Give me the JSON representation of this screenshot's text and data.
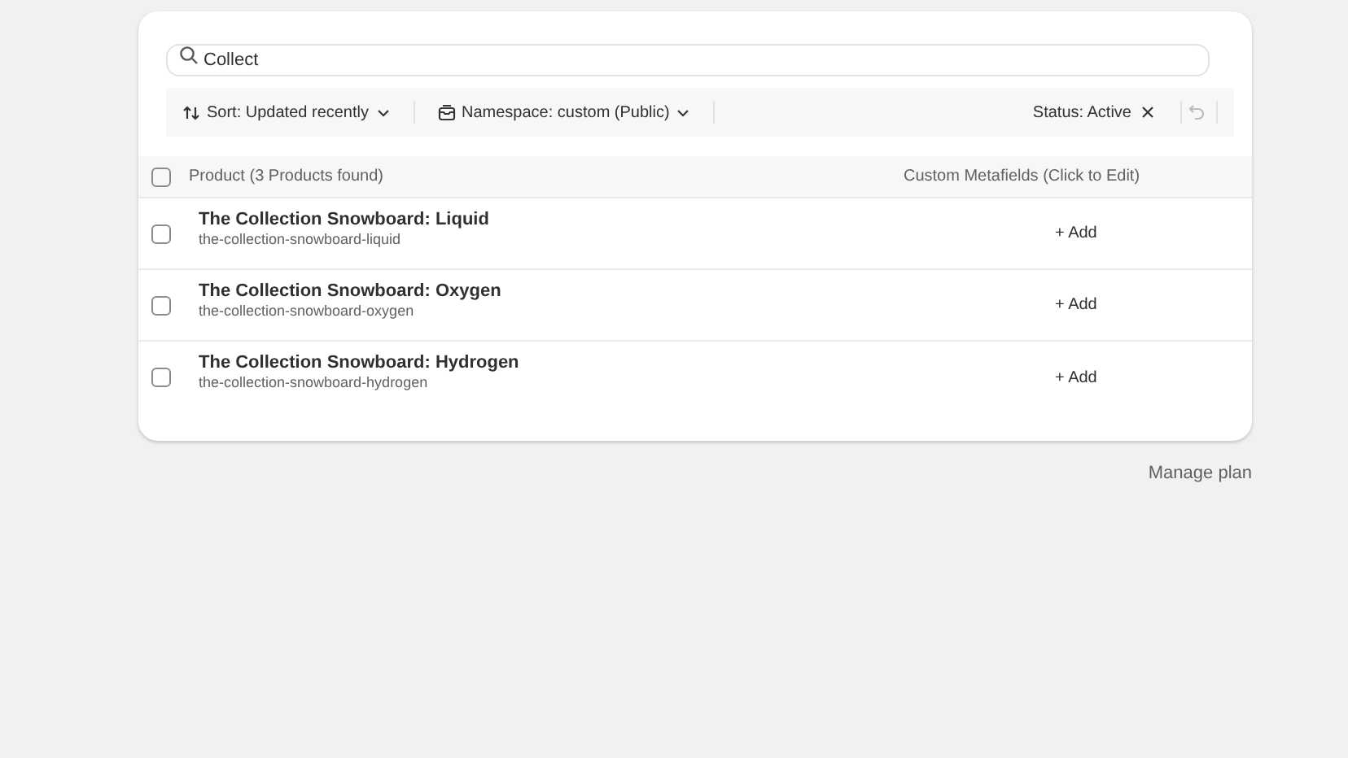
{
  "search": {
    "value": "Collect"
  },
  "filters": {
    "sort": "Sort: Updated recently",
    "namespace": "Namespace: custom (Public)",
    "status": "Status: Active"
  },
  "table": {
    "columns": [
      "Product (3 Products found)",
      "Custom Metafields (Click to Edit)"
    ],
    "all_selected": false,
    "rows": [
      {
        "title": "The Collection Snowboard: Liquid",
        "handle": "the-collection-snowboard-liquid",
        "selected": false,
        "action": "+ Add"
      },
      {
        "title": "The Collection Snowboard: Oxygen",
        "handle": "the-collection-snowboard-oxygen",
        "selected": false,
        "action": "+ Add"
      },
      {
        "title": "The Collection Snowboard: Hydrogen",
        "handle": "the-collection-snowboard-hydrogen",
        "selected": false,
        "action": "+ Add"
      }
    ]
  },
  "footer_link": "Manage plan"
}
